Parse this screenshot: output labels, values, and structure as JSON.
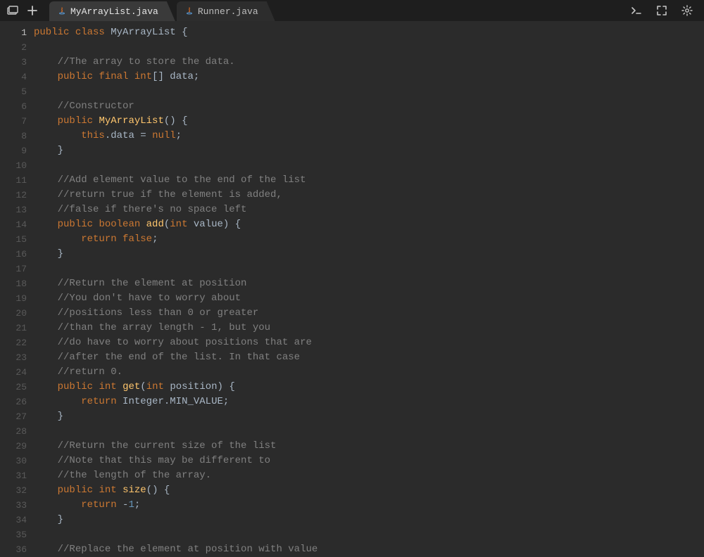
{
  "tabs": [
    {
      "label": "MyArrayList.java",
      "active": true
    },
    {
      "label": "Runner.java",
      "active": false
    }
  ],
  "icons": {
    "files": "files-icon",
    "plus": "plus-icon",
    "terminal": "terminal-icon",
    "fullscreen": "fullscreen-icon",
    "settings": "settings-icon",
    "java": "java-icon"
  },
  "code_lines": [
    {
      "n": 1,
      "tokens": [
        [
          "kw",
          "public"
        ],
        [
          "sp",
          " "
        ],
        [
          "kw",
          "class"
        ],
        [
          "sp",
          " "
        ],
        [
          "cls",
          "MyArrayList"
        ],
        [
          "sp",
          " "
        ],
        [
          "brace",
          "{"
        ]
      ]
    },
    {
      "n": 2,
      "tokens": []
    },
    {
      "n": 3,
      "tokens": [
        [
          "sp",
          "    "
        ],
        [
          "cm",
          "//The array to store the data."
        ]
      ]
    },
    {
      "n": 4,
      "tokens": [
        [
          "sp",
          "    "
        ],
        [
          "kw",
          "public"
        ],
        [
          "sp",
          " "
        ],
        [
          "kw",
          "final"
        ],
        [
          "sp",
          " "
        ],
        [
          "kw",
          "int"
        ],
        [
          "pn",
          "[]"
        ],
        [
          "sp",
          " "
        ],
        [
          "id",
          "data"
        ],
        [
          "pn",
          ";"
        ]
      ]
    },
    {
      "n": 5,
      "tokens": []
    },
    {
      "n": 6,
      "tokens": [
        [
          "sp",
          "    "
        ],
        [
          "cm",
          "//Constructor"
        ]
      ]
    },
    {
      "n": 7,
      "tokens": [
        [
          "sp",
          "    "
        ],
        [
          "kw",
          "public"
        ],
        [
          "sp",
          " "
        ],
        [
          "fn",
          "MyArrayList"
        ],
        [
          "pn",
          "()"
        ],
        [
          "sp",
          " "
        ],
        [
          "brace",
          "{"
        ]
      ]
    },
    {
      "n": 8,
      "tokens": [
        [
          "sp",
          "        "
        ],
        [
          "kw",
          "this"
        ],
        [
          "pn",
          "."
        ],
        [
          "id",
          "data"
        ],
        [
          "sp",
          " "
        ],
        [
          "pn",
          "="
        ],
        [
          "sp",
          " "
        ],
        [
          "kw",
          "null"
        ],
        [
          "pn",
          ";"
        ]
      ]
    },
    {
      "n": 9,
      "tokens": [
        [
          "sp",
          "    "
        ],
        [
          "brace",
          "}"
        ]
      ]
    },
    {
      "n": 10,
      "tokens": []
    },
    {
      "n": 11,
      "tokens": [
        [
          "sp",
          "    "
        ],
        [
          "cm",
          "//Add element value to the end of the list"
        ]
      ]
    },
    {
      "n": 12,
      "tokens": [
        [
          "sp",
          "    "
        ],
        [
          "cm",
          "//return true if the element is added,"
        ]
      ]
    },
    {
      "n": 13,
      "tokens": [
        [
          "sp",
          "    "
        ],
        [
          "cm",
          "//false if there's no space left"
        ]
      ]
    },
    {
      "n": 14,
      "tokens": [
        [
          "sp",
          "    "
        ],
        [
          "kw",
          "public"
        ],
        [
          "sp",
          " "
        ],
        [
          "kw",
          "boolean"
        ],
        [
          "sp",
          " "
        ],
        [
          "fn",
          "add"
        ],
        [
          "pn",
          "("
        ],
        [
          "kw",
          "int"
        ],
        [
          "sp",
          " "
        ],
        [
          "id",
          "value"
        ],
        [
          "pn",
          ")"
        ],
        [
          "sp",
          " "
        ],
        [
          "brace",
          "{"
        ]
      ]
    },
    {
      "n": 15,
      "tokens": [
        [
          "sp",
          "        "
        ],
        [
          "kw",
          "return"
        ],
        [
          "sp",
          " "
        ],
        [
          "kw",
          "false"
        ],
        [
          "pn",
          ";"
        ]
      ]
    },
    {
      "n": 16,
      "tokens": [
        [
          "sp",
          "    "
        ],
        [
          "brace",
          "}"
        ]
      ]
    },
    {
      "n": 17,
      "tokens": []
    },
    {
      "n": 18,
      "tokens": [
        [
          "sp",
          "    "
        ],
        [
          "cm",
          "//Return the element at position"
        ]
      ]
    },
    {
      "n": 19,
      "tokens": [
        [
          "sp",
          "    "
        ],
        [
          "cm",
          "//You don't have to worry about"
        ]
      ]
    },
    {
      "n": 20,
      "tokens": [
        [
          "sp",
          "    "
        ],
        [
          "cm",
          "//positions less than 0 or greater"
        ]
      ]
    },
    {
      "n": 21,
      "tokens": [
        [
          "sp",
          "    "
        ],
        [
          "cm",
          "//than the array length - 1, but you"
        ]
      ]
    },
    {
      "n": 22,
      "tokens": [
        [
          "sp",
          "    "
        ],
        [
          "cm",
          "//do have to worry about positions that are"
        ]
      ]
    },
    {
      "n": 23,
      "tokens": [
        [
          "sp",
          "    "
        ],
        [
          "cm",
          "//after the end of the list. In that case"
        ]
      ]
    },
    {
      "n": 24,
      "tokens": [
        [
          "sp",
          "    "
        ],
        [
          "cm",
          "//return 0."
        ]
      ]
    },
    {
      "n": 25,
      "tokens": [
        [
          "sp",
          "    "
        ],
        [
          "kw",
          "public"
        ],
        [
          "sp",
          " "
        ],
        [
          "kw",
          "int"
        ],
        [
          "sp",
          " "
        ],
        [
          "fn",
          "get"
        ],
        [
          "pn",
          "("
        ],
        [
          "kw",
          "int"
        ],
        [
          "sp",
          " "
        ],
        [
          "id",
          "position"
        ],
        [
          "pn",
          ")"
        ],
        [
          "sp",
          " "
        ],
        [
          "brace",
          "{"
        ]
      ]
    },
    {
      "n": 26,
      "tokens": [
        [
          "sp",
          "        "
        ],
        [
          "kw",
          "return"
        ],
        [
          "sp",
          " "
        ],
        [
          "id",
          "Integer"
        ],
        [
          "pn",
          "."
        ],
        [
          "id",
          "MIN_VALUE"
        ],
        [
          "pn",
          ";"
        ]
      ]
    },
    {
      "n": 27,
      "tokens": [
        [
          "sp",
          "    "
        ],
        [
          "brace",
          "}"
        ]
      ]
    },
    {
      "n": 28,
      "tokens": []
    },
    {
      "n": 29,
      "tokens": [
        [
          "sp",
          "    "
        ],
        [
          "cm",
          "//Return the current size of the list"
        ]
      ]
    },
    {
      "n": 30,
      "tokens": [
        [
          "sp",
          "    "
        ],
        [
          "cm",
          "//Note that this may be different to"
        ]
      ]
    },
    {
      "n": 31,
      "tokens": [
        [
          "sp",
          "    "
        ],
        [
          "cm",
          "//the length of the array."
        ]
      ]
    },
    {
      "n": 32,
      "tokens": [
        [
          "sp",
          "    "
        ],
        [
          "kw",
          "public"
        ],
        [
          "sp",
          " "
        ],
        [
          "kw",
          "int"
        ],
        [
          "sp",
          " "
        ],
        [
          "fn",
          "size"
        ],
        [
          "pn",
          "()"
        ],
        [
          "sp",
          " "
        ],
        [
          "brace",
          "{"
        ]
      ]
    },
    {
      "n": 33,
      "tokens": [
        [
          "sp",
          "        "
        ],
        [
          "kw",
          "return"
        ],
        [
          "sp",
          " "
        ],
        [
          "pn",
          "-"
        ],
        [
          "num",
          "1"
        ],
        [
          "pn",
          ";"
        ]
      ]
    },
    {
      "n": 34,
      "tokens": [
        [
          "sp",
          "    "
        ],
        [
          "brace",
          "}"
        ]
      ]
    },
    {
      "n": 35,
      "tokens": []
    },
    {
      "n": 36,
      "tokens": [
        [
          "sp",
          "    "
        ],
        [
          "cm",
          "//Replace the element at position with value"
        ]
      ]
    }
  ]
}
